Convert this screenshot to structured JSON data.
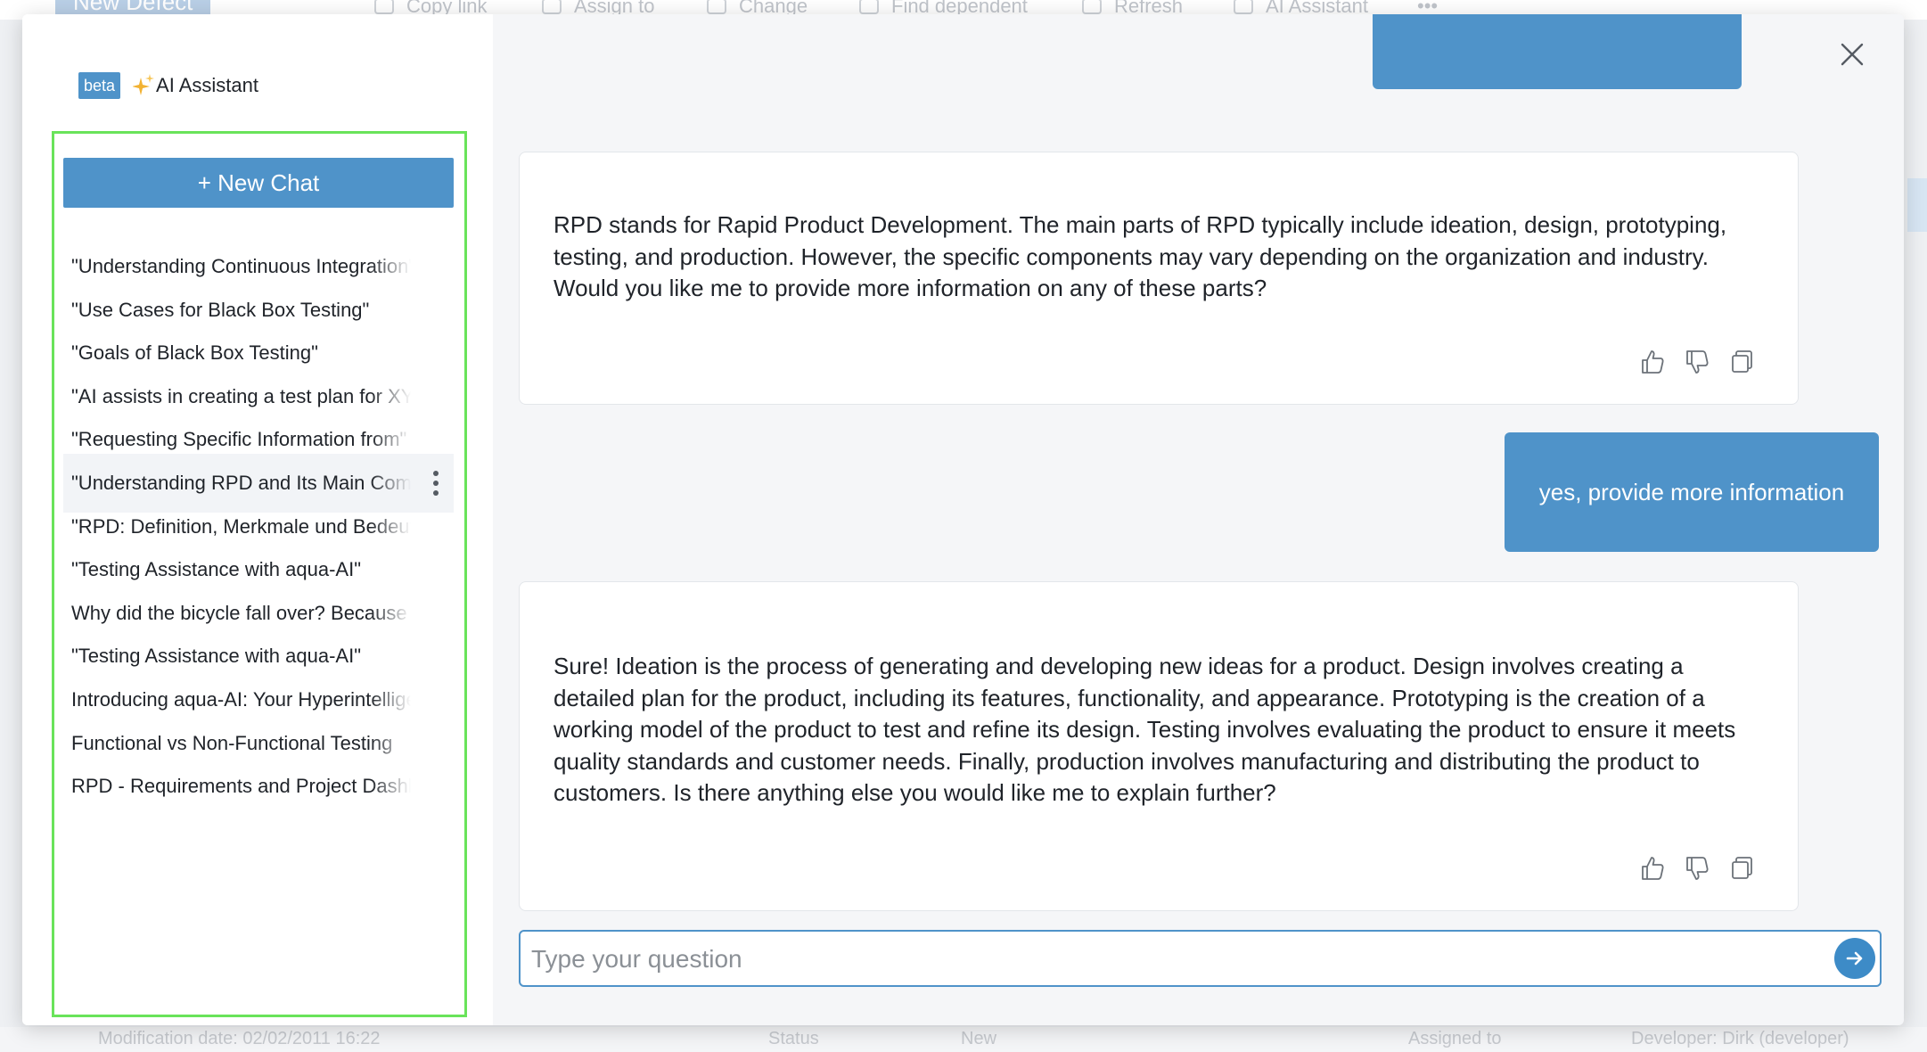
{
  "background": {
    "new_defect": "New Defect",
    "toolbar": [
      "Copy link",
      "Assign to",
      "Change",
      "Find dependent",
      "Refresh",
      "AI Assistant"
    ],
    "more": "•••",
    "bottom": [
      "Modification date:  02/02/2011 16:22",
      "Status",
      "New",
      "Assigned to",
      "Developer: Dirk (developer)"
    ]
  },
  "sidebar": {
    "beta_label": "beta",
    "title": "AI Assistant",
    "new_chat_label": "+ New Chat",
    "history": [
      "\"Understanding Continuous Integration\"",
      "\"Use Cases for Black Box Testing\"",
      "\"Goals of Black Box Testing\"",
      "\"AI assists in creating a test plan for XYZ\"",
      "\"Requesting Specific Information from\"",
      "\"Understanding RPD and Its Main Components\"",
      "\"RPD: Definition, Merkmale und Bedeutung\"",
      "\"Testing Assistance with aqua-AI\"",
      "Why did the bicycle fall over? Because",
      "\"Testing Assistance with aqua-AI\"",
      "Introducing aqua-AI: Your Hyperintelligent",
      "Functional vs Non-Functional Testing",
      "RPD - Requirements and Project Dashboard"
    ],
    "active_index": 5
  },
  "chat": {
    "messages": [
      {
        "role": "assistant",
        "text": "RPD stands for Rapid Product Development. The main parts of RPD typically include ideation, design, prototyping, testing, and production. However, the specific components may vary depending on the organization and industry. Would you like me to provide more information on any of these parts?"
      },
      {
        "role": "user",
        "text": "yes, provide more information"
      },
      {
        "role": "assistant",
        "text": "Sure! Ideation is the process of generating and developing new ideas for a product. Design involves creating a detailed plan for the product, including its features, functionality, and appearance. Prototyping is the creation of a working model of the product to test and refine its design. Testing involves evaluating the product to ensure it meets quality standards and customer needs. Finally, production involves manufacturing and distributing the product to customers. Is there anything else you would like me to explain further?"
      }
    ],
    "input_placeholder": "Type your question",
    "input_value": ""
  },
  "icons": {
    "close": "close-icon",
    "thumbs_up": "thumbs-up-icon",
    "thumbs_down": "thumbs-down-icon",
    "copy": "copy-icon",
    "send": "arrow-right-icon",
    "sparkle": "sparkle-icon",
    "more": "more-vertical-icon"
  },
  "colors": {
    "accent": "#4f93c9",
    "highlight_border": "#69e35a"
  }
}
